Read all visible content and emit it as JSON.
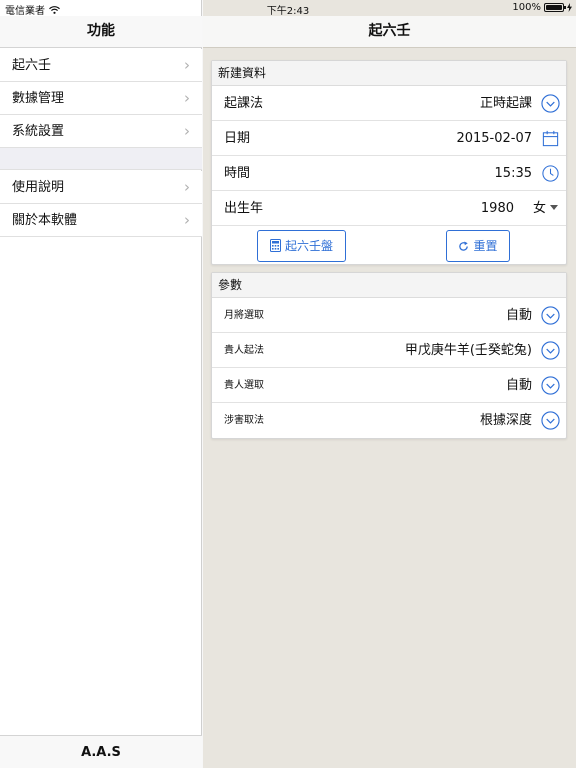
{
  "status_bar": {
    "carrier": "電信業者",
    "time": "下午2:43",
    "battery": "100%",
    "battery_level": 1.0
  },
  "master": {
    "title": "功能",
    "items": [
      {
        "label": "起六壬"
      },
      {
        "label": "數據管理"
      },
      {
        "label": "系統設置"
      },
      {
        "label": "使用說明"
      },
      {
        "label": "關於本軟體"
      }
    ],
    "footer": "A.A.S"
  },
  "detail": {
    "title": "起六壬",
    "new_record": {
      "header": "新建資料",
      "method_label": "起課法",
      "method_value": "正時起課",
      "date_label": "日期",
      "date_value": "2015-02-07",
      "time_label": "時間",
      "time_value": "15:35",
      "birth_year_label": "出生年",
      "birth_year_value": "1980",
      "gender_value": "女",
      "submit_label": "起六壬盤",
      "reset_label": "重置"
    },
    "params": {
      "header": "參數",
      "rows": [
        {
          "label": "月將選取",
          "value": "自動"
        },
        {
          "label": "貴人起法",
          "value": "甲戊庚牛羊(壬癸蛇兔)"
        },
        {
          "label": "貴人選取",
          "value": "自動"
        },
        {
          "label": "涉害取法",
          "value": "根據深度"
        }
      ]
    }
  },
  "colors": {
    "accent": "#2f6fd6",
    "background": "#e8e5de"
  }
}
